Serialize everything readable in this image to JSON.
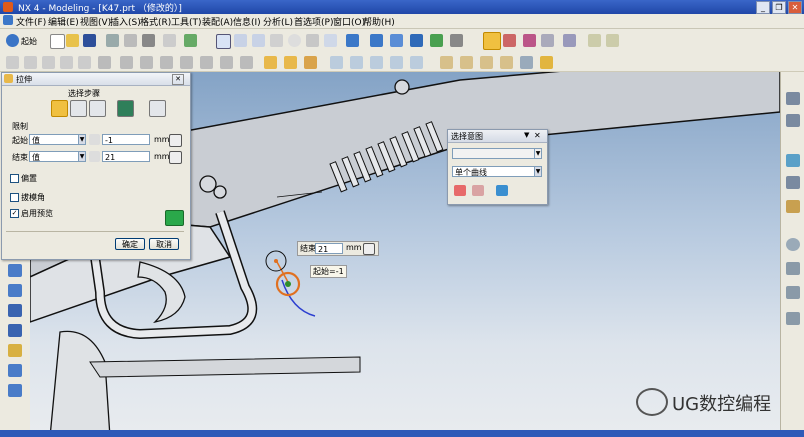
{
  "window": {
    "title": "NX 4 - Modeling - [K47.prt （修改的）]"
  },
  "menu": [
    "文件(F)",
    "编辑(E)",
    "视图(V)",
    "插入(S)",
    "格式(R)",
    "工具(T)",
    "装配(A)",
    "信息(I)",
    "分析(L)",
    "首选项(P)",
    "窗口(O)",
    "帮助(H)"
  ],
  "toolbar": {
    "start_label": "起始"
  },
  "extrude_dialog": {
    "title": "拉伸",
    "selection_steps_label": "选择步骤",
    "limits_label": "限制",
    "start_label": "起始",
    "start_type": "值",
    "start_value": "-1",
    "start_unit": "mm",
    "end_label": "结束",
    "end_type": "值",
    "end_value": "21",
    "end_unit": "mm",
    "offset_label": "偏置",
    "draft_label": "拔模角",
    "preview_label": "启用预览",
    "ok_label": "确定",
    "cancel_label": "取消"
  },
  "selection_intent": {
    "title": "选择意图",
    "filter_value": "",
    "curve_rule": "单个曲线"
  },
  "handles": {
    "end_label": "结束",
    "end_value": "21",
    "end_unit": "mm",
    "start_label": "起始=-1"
  },
  "watermark": {
    "text": "UG数控编程"
  },
  "colors": {
    "title_bar": "#2a58bd",
    "viewport_top": "#84a3c6",
    "viewport_bottom": "#e9ecef",
    "handle_orange": "#e07020"
  }
}
